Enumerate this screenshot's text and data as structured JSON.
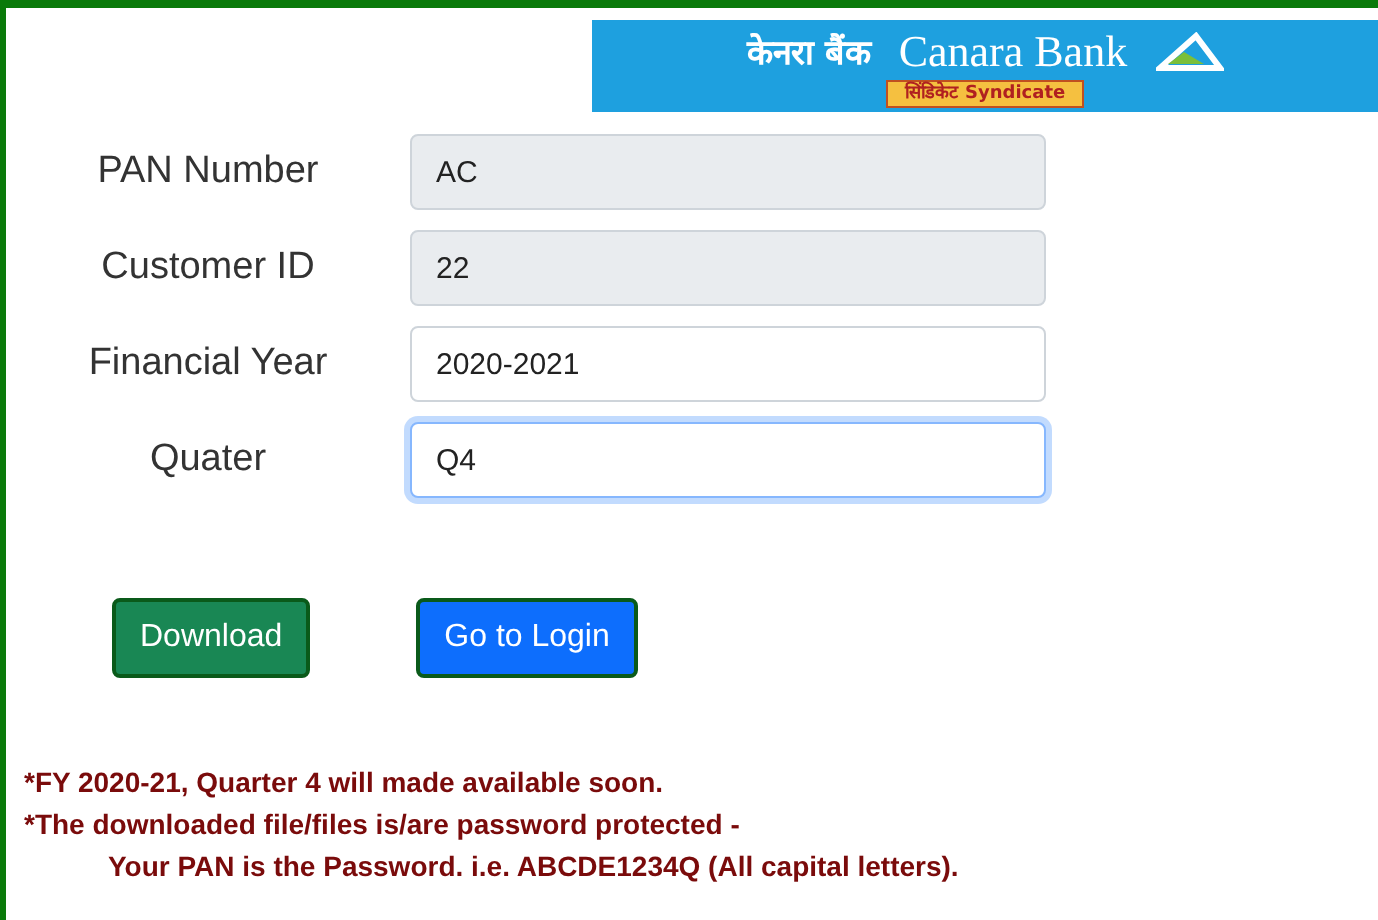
{
  "logo": {
    "hindi_name": "केनरा बैंक",
    "name": "Canara Bank",
    "merger_hindi": "सिंडिकेट",
    "merger_name": "Syndicate"
  },
  "fields": [
    {
      "label": "PAN Number",
      "value": "AC",
      "disabled": true,
      "focused": false
    },
    {
      "label": "Customer ID",
      "value": "22",
      "disabled": true,
      "focused": false
    },
    {
      "label": "Financial Year",
      "value": "2020-2021",
      "disabled": false,
      "focused": false
    },
    {
      "label": "Quater",
      "value": "Q4",
      "disabled": false,
      "focused": true
    }
  ],
  "buttons": [
    {
      "label": "Download",
      "kind": "success"
    },
    {
      "label": "Go to Login",
      "kind": "primary"
    }
  ],
  "notes": [
    {
      "text": "*FY 2020-21, Quarter 4 will made available soon.",
      "indented": false
    },
    {
      "text": "*The downloaded file/files is/are password protected -",
      "indented": false
    },
    {
      "text": "Your PAN is the Password. i.e. ABCDE1234Q (All capital letters).",
      "indented": true
    }
  ]
}
